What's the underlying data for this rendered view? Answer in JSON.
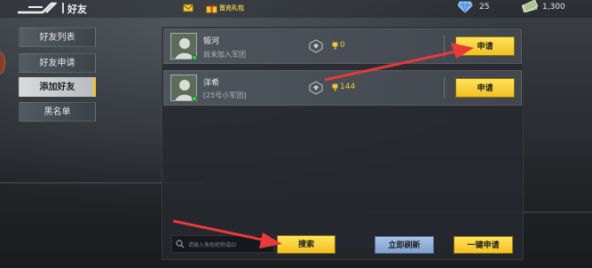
{
  "header": {
    "title": "好友",
    "gift_label": "首充礼包",
    "gems": "25",
    "cash": "1,300"
  },
  "sidebar": {
    "items": [
      {
        "label": "好友列表",
        "active": false
      },
      {
        "label": "好友申请",
        "active": false
      },
      {
        "label": "添加好友",
        "active": true
      },
      {
        "label": "黑名单",
        "active": false
      }
    ]
  },
  "players": [
    {
      "name": "锻河",
      "sub": "尚未加入军团",
      "trophies": "0",
      "action": "申请"
    },
    {
      "name": "洋希",
      "sub": "[25号小军团]",
      "trophies": "144",
      "action": "申请"
    }
  ],
  "bottom": {
    "search_placeholder": "请输入角色昵称或ID",
    "search_button": "搜索",
    "refresh_button": "立即刷新",
    "apply_all_button": "一键申请"
  },
  "colors": {
    "accent_yellow": "#f2c531",
    "refresh_blue": "#8fb0de",
    "online_green": "#35d25a",
    "annotation_red": "#e83a3a"
  },
  "icons": [
    "back-logo-icon",
    "mail-icon",
    "gift-icon",
    "gem-icon",
    "cash-icon",
    "rank-icon",
    "trophy-icon",
    "search-icon"
  ]
}
